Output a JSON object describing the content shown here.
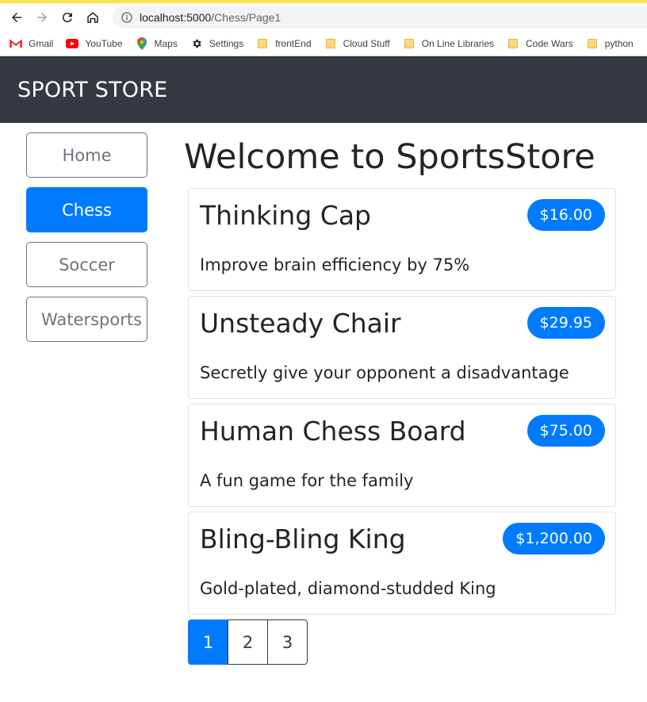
{
  "browser": {
    "url_host": "localhost:5000",
    "url_path": "/Chess/Page1",
    "bookmarks": [
      {
        "label": "Gmail",
        "icon": "gmail-icon"
      },
      {
        "label": "YouTube",
        "icon": "youtube-icon"
      },
      {
        "label": "Maps",
        "icon": "maps-icon"
      },
      {
        "label": "Settings",
        "icon": "gear-icon"
      },
      {
        "label": "frontEnd",
        "icon": "folder-icon"
      },
      {
        "label": "Cloud Stuff",
        "icon": "folder-icon"
      },
      {
        "label": "On Line Libraries",
        "icon": "folder-icon"
      },
      {
        "label": "Code Wars",
        "icon": "folder-icon"
      },
      {
        "label": "python",
        "icon": "folder-icon"
      }
    ]
  },
  "navbar": {
    "brand": "SPORT STORE"
  },
  "sidebar": {
    "items": [
      {
        "label": "Home",
        "active": false
      },
      {
        "label": "Chess",
        "active": true
      },
      {
        "label": "Soccer",
        "active": false
      },
      {
        "label": "Watersports",
        "active": false
      }
    ]
  },
  "main": {
    "title": "Welcome to SportsStore",
    "products": [
      {
        "name": "Thinking Cap",
        "price": "$16.00",
        "description": "Improve brain efficiency by 75%"
      },
      {
        "name": "Unsteady Chair",
        "price": "$29.95",
        "description": "Secretly give your opponent a disadvantage"
      },
      {
        "name": "Human Chess Board",
        "price": "$75.00",
        "description": "A fun game for the family"
      },
      {
        "name": "Bling-Bling King",
        "price": "$1,200.00",
        "description": "Gold-plated, diamond-studded King"
      }
    ],
    "pagination": [
      {
        "label": "1",
        "active": true
      },
      {
        "label": "2",
        "active": false
      },
      {
        "label": "3",
        "active": false
      }
    ]
  },
  "colors": {
    "primary": "#007bff",
    "navbar": "#343a40",
    "secondary": "#6c757d"
  }
}
